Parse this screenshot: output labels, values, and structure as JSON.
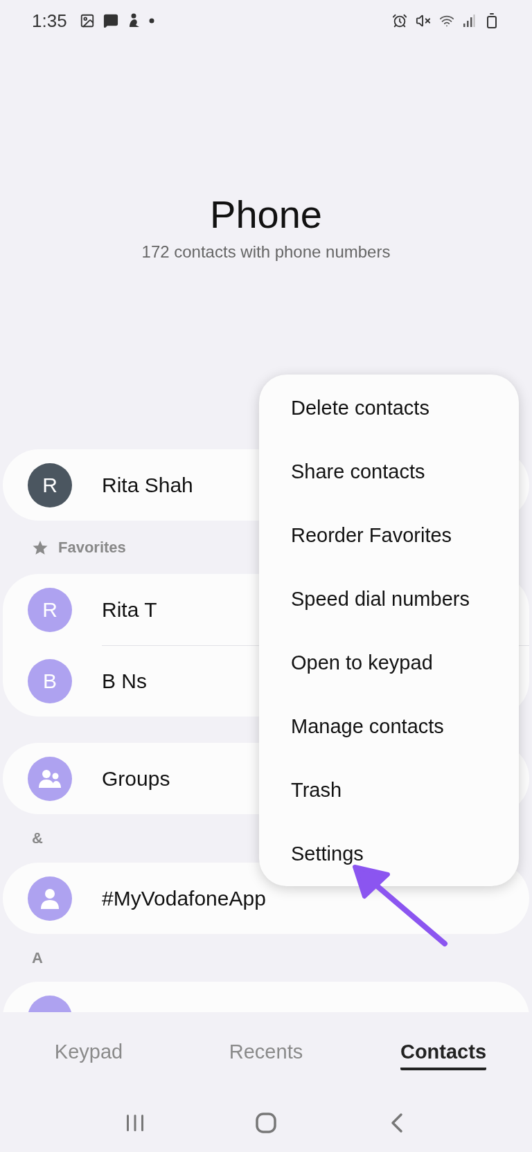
{
  "status_bar": {
    "time": "1:35"
  },
  "header": {
    "title": "Phone",
    "subtitle": "172 contacts with phone numbers"
  },
  "sections": [
    {
      "rows": [
        {
          "name": "Rita Shah",
          "avatar": {
            "kind": "letter",
            "letter": "R",
            "color": "#4b5660"
          }
        }
      ]
    },
    {
      "label": "Favorites",
      "kind": "favorites",
      "rows": [
        {
          "name": "Rita T",
          "avatar": {
            "kind": "letter",
            "letter": "R",
            "color": "#aea2f0"
          }
        },
        {
          "name": "B Ns",
          "avatar": {
            "kind": "letter",
            "letter": "B",
            "color": "#aea2f0"
          }
        }
      ]
    },
    {
      "rows": [
        {
          "name": "Groups",
          "avatar": {
            "kind": "group",
            "color": "#aea2f0"
          }
        }
      ]
    },
    {
      "label": "&",
      "kind": "letter",
      "rows": [
        {
          "name": "#MyVodafoneApp",
          "avatar": {
            "kind": "person",
            "color": "#aea2f0"
          }
        }
      ]
    },
    {
      "label": "A",
      "kind": "letter",
      "rows": [
        {
          "avatar": {
            "kind": "plain",
            "color": "#aea2f0"
          }
        }
      ]
    }
  ],
  "menu": {
    "items": [
      "Delete contacts",
      "Share contacts",
      "Reorder Favorites",
      "Speed dial numbers",
      "Open to keypad",
      "Manage contacts",
      "Trash",
      "Settings"
    ]
  },
  "tabs": [
    {
      "label": "Keypad",
      "selected": false
    },
    {
      "label": "Recents",
      "selected": false
    },
    {
      "label": "Contacts",
      "selected": true
    }
  ]
}
